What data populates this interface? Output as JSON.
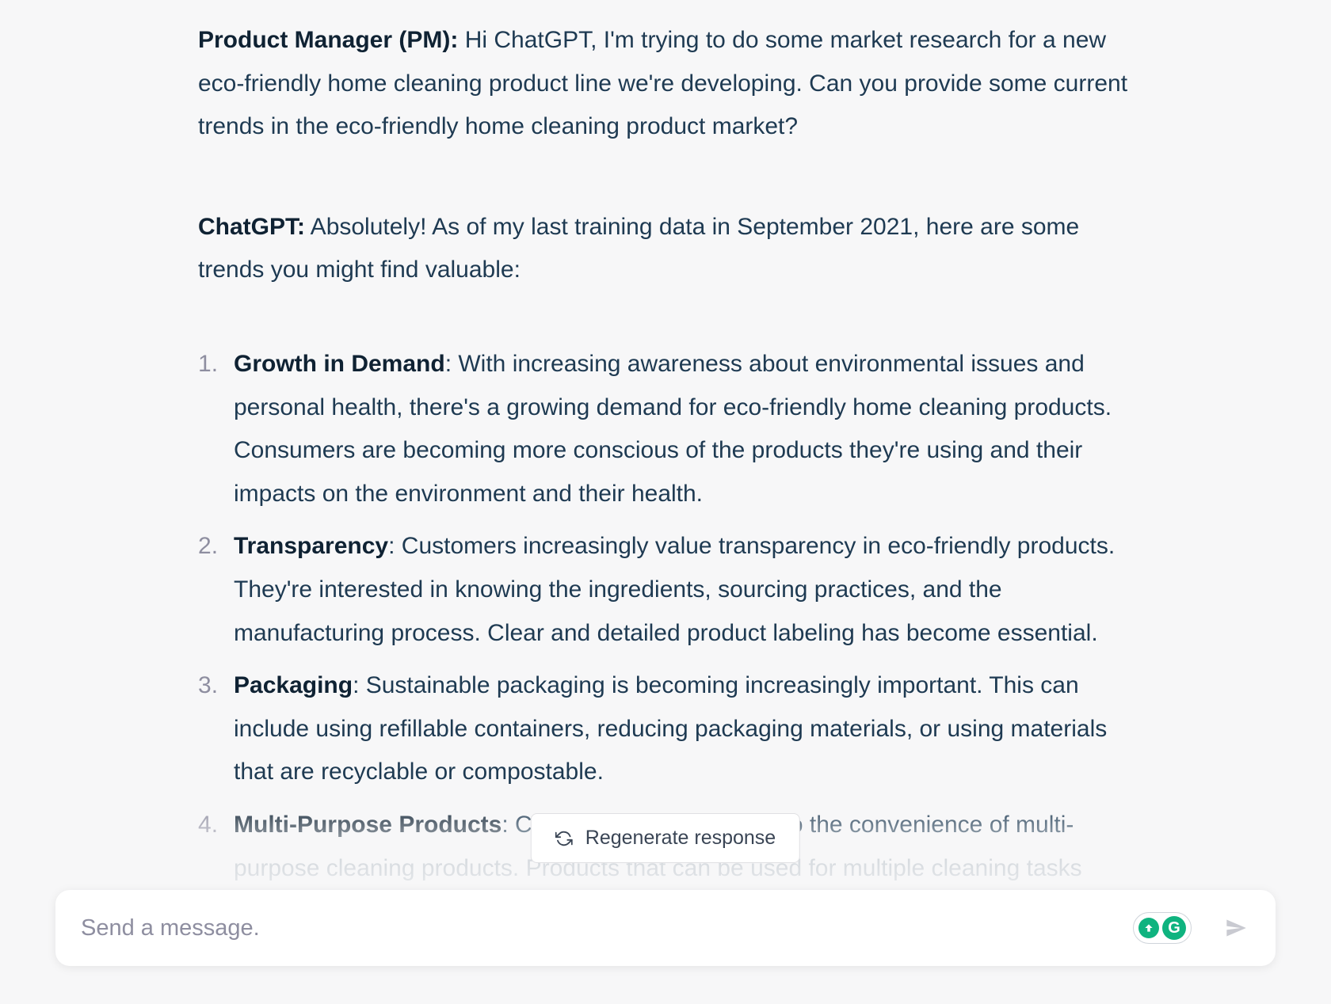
{
  "conversation": {
    "user_speaker": "Product Manager (PM):",
    "user_text": " Hi ChatGPT, I'm trying to do some market research for a new eco-friendly home cleaning product line we're developing. Can you provide some current trends in the eco-friendly home cleaning product market?",
    "assistant_speaker": "ChatGPT:",
    "assistant_intro": " Absolutely! As of my last training data in September 2021, here are some trends you might find valuable:",
    "trends": [
      {
        "title": "Growth in Demand",
        "body": ": With increasing awareness about environmental issues and personal health, there's a growing demand for eco-friendly home cleaning products. Consumers are becoming more conscious of the products they're using and their impacts on the environment and their health."
      },
      {
        "title": "Transparency",
        "body": ": Customers increasingly value transparency in eco-friendly products. They're interested in knowing the ingredients, sourcing practices, and the manufacturing process. Clear and detailed product labeling has become essential."
      },
      {
        "title": "Packaging",
        "body": ": Sustainable packaging is becoming increasingly important. This can include using refillable containers, reducing packaging materials, or using materials that are recyclable or compostable."
      },
      {
        "title": "Multi-Purpose Products",
        "body": ": Consumers are attracted to the convenience of multi-purpose cleaning products. Products that can be used for multiple cleaning tasks reduce the need for multiple product purchases, which is more economical and better for the environment."
      }
    ]
  },
  "controls": {
    "regenerate": "Regenerate response",
    "input_placeholder": "Send a message.",
    "grammarly_letter": "G"
  }
}
